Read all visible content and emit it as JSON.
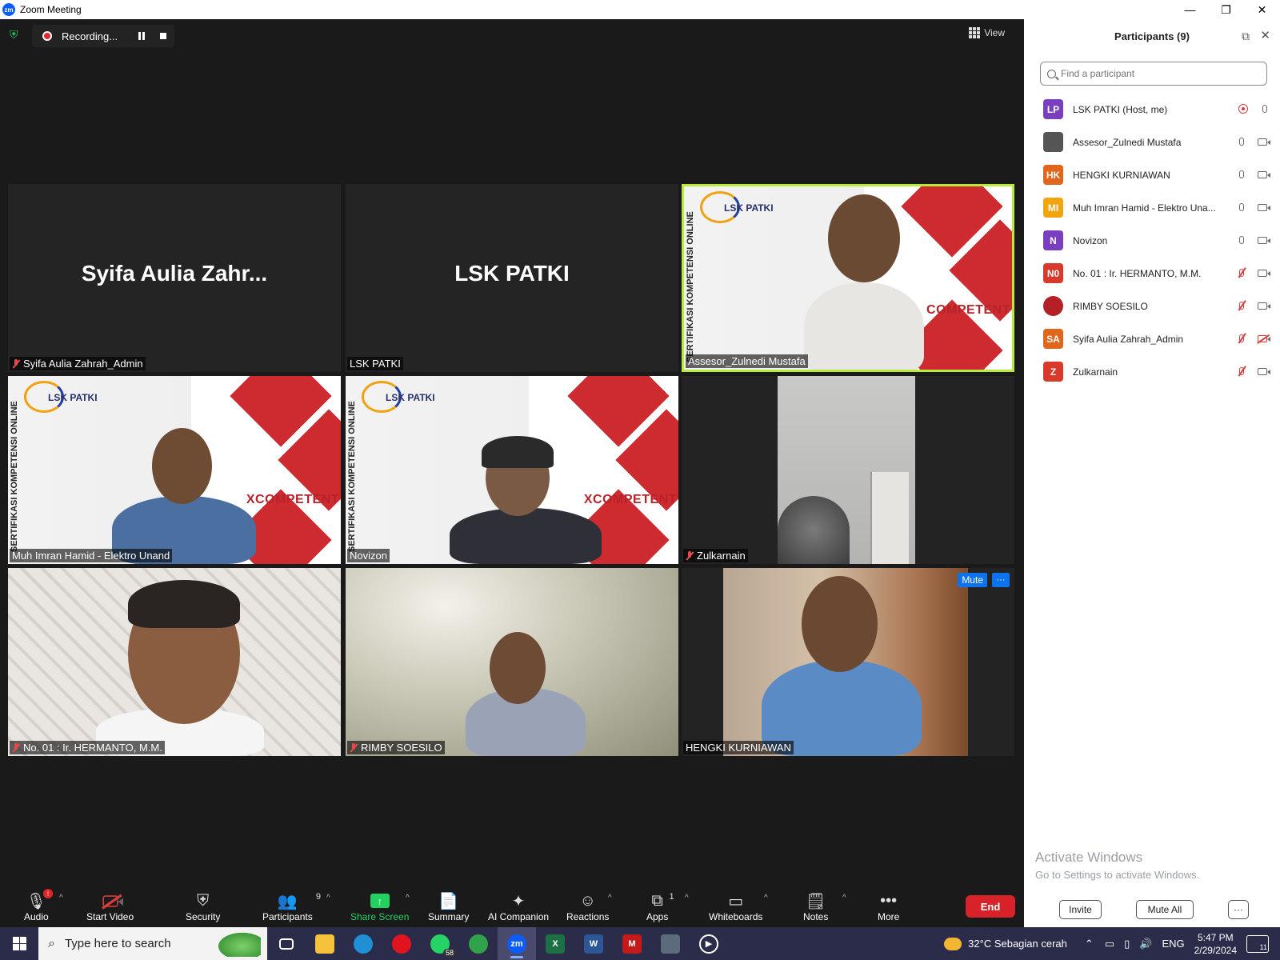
{
  "window": {
    "title": "Zoom Meeting",
    "logo_text": "zm"
  },
  "top": {
    "recording_label": "Recording...",
    "view_label": "View"
  },
  "tiles": [
    {
      "bigname": "Syifa Aulia Zahr...",
      "label": "Syifa Aulia Zahrah_Admin",
      "muted": true
    },
    {
      "bigname": "LSK PATKI",
      "label": "LSK PATKI",
      "muted": false
    },
    {
      "label": "Assesor_Zulnedi Mustafa",
      "muted": false,
      "active_speaker": true
    },
    {
      "label": "Muh Imran Hamid - Elektro Unand",
      "muted": false
    },
    {
      "label": "Novizon",
      "muted": false
    },
    {
      "label": "Zulkarnain",
      "muted": true
    },
    {
      "label": "No. 01 : Ir. HERMANTO, M.M.",
      "muted": true
    },
    {
      "label": "RIMBY SOESILO",
      "muted": true
    },
    {
      "label": "HENGKI KURNIAWAN",
      "muted": false
    }
  ],
  "banner": {
    "logo_text": "LSK PATKI",
    "side_text": "SERTIFIKASI KOMPETENSI ONLINE",
    "competent": "COMPETENT",
    "competent2": "XCOMPETENT"
  },
  "tile_hover": {
    "mute": "Mute",
    "more": "···"
  },
  "toolbar": {
    "audio": "Audio",
    "start_video": "Start Video",
    "security": "Security",
    "participants": "Participants",
    "participants_count": "9",
    "share_screen": "Share Screen",
    "summary": "Summary",
    "ai_companion": "AI Companion",
    "reactions": "Reactions",
    "apps": "Apps",
    "apps_count": "1",
    "whiteboards": "Whiteboards",
    "notes": "Notes",
    "more": "More",
    "end": "End",
    "audio_badge": "!"
  },
  "panel": {
    "title": "Participants (9)",
    "search_placeholder": "Find a participant",
    "participants": [
      {
        "initials": "LP",
        "name": "LSK PATKI (Host, me)",
        "color": "#7a3fbf"
      },
      {
        "initials": "",
        "name": "Assesor_Zulnedi Mustafa",
        "color": "#555555"
      },
      {
        "initials": "HK",
        "name": "HENGKI KURNIAWAN",
        "color": "#e0661c"
      },
      {
        "initials": "MI",
        "name": "Muh Imran Hamid - Elektro Una...",
        "color": "#f2a40f"
      },
      {
        "initials": "N",
        "name": "Novizon",
        "color": "#7a3fbf"
      },
      {
        "initials": "N0",
        "name": "No. 01 : Ir. HERMANTO, M.M.",
        "color": "#d9392a"
      },
      {
        "initials": "",
        "name": "RIMBY SOESILO",
        "color": "#b42025"
      },
      {
        "initials": "SA",
        "name": "Syifa Aulia Zahrah_Admin",
        "color": "#e0661c"
      },
      {
        "initials": "Z",
        "name": "Zulkarnain",
        "color": "#d9392a"
      }
    ],
    "activate_title": "Activate Windows",
    "activate_sub": "Go to Settings to activate Windows.",
    "invite": "Invite",
    "mute_all": "Mute All",
    "more": "···"
  },
  "taskbar": {
    "search_placeholder": "Type here to search",
    "whatsapp_badge": "58",
    "weather": "32°C  Sebagian cerah",
    "lang": "ENG",
    "time": "5:47 PM",
    "date": "2/29/2024",
    "notifications": "11",
    "apps": [
      "task-view",
      "file-explorer",
      "edge",
      "opera",
      "whatsapp",
      "chrome",
      "zoom",
      "excel",
      "word",
      "mcafee",
      "calculator",
      "media-player"
    ]
  }
}
